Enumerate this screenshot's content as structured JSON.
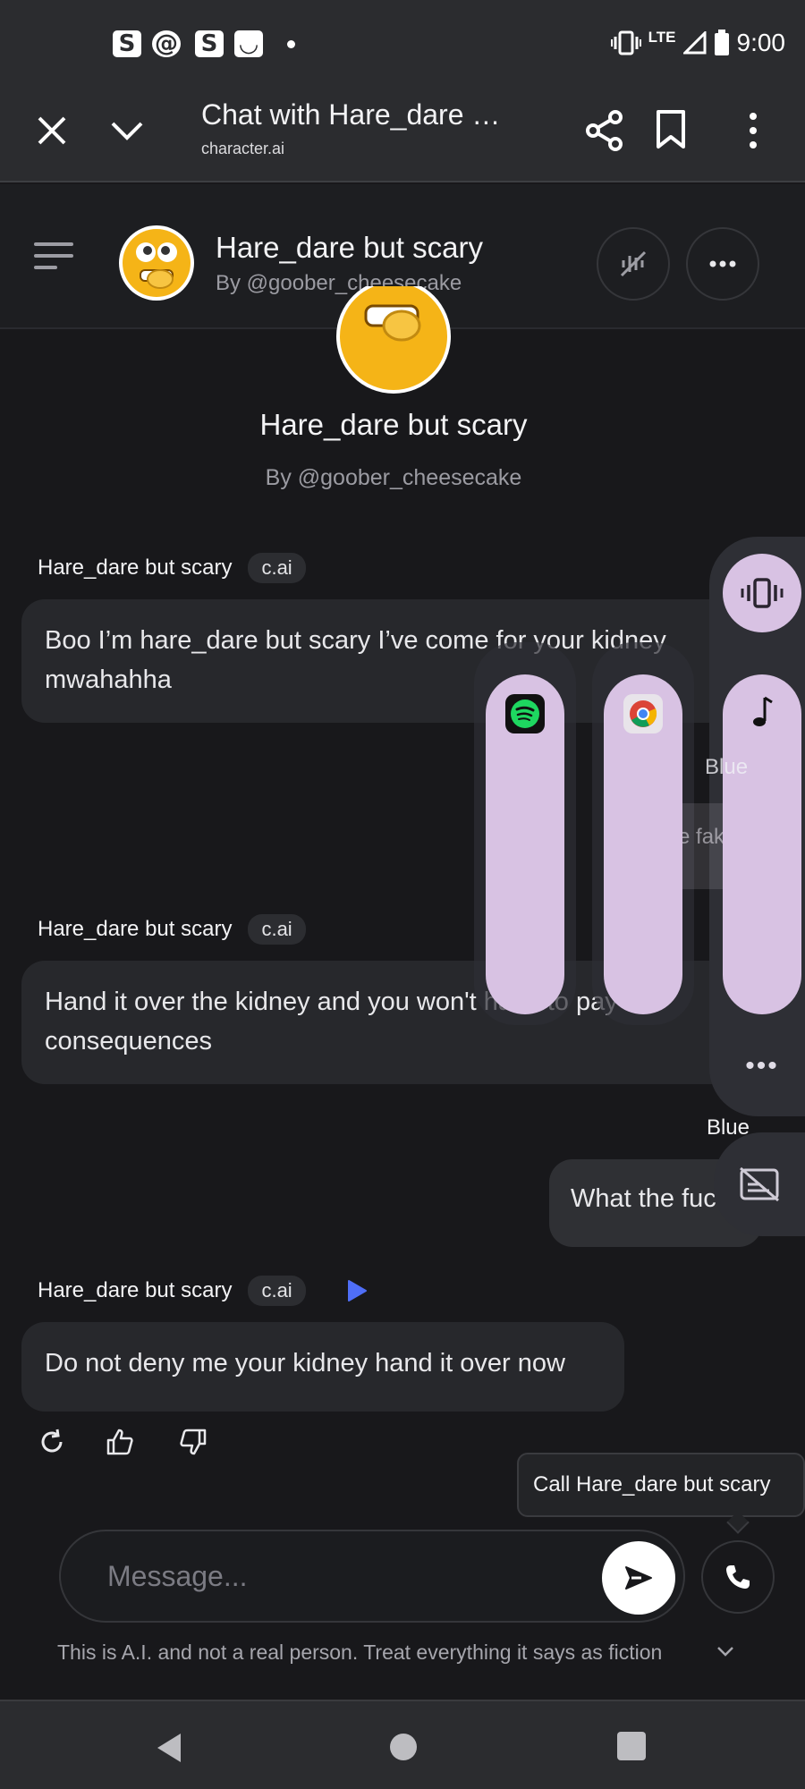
{
  "status_bar": {
    "left_icons": [
      "S",
      "@",
      "S",
      "◡"
    ],
    "network": "LTE",
    "time": "9:00"
  },
  "browser": {
    "title": "Chat with Hare_dare …",
    "url": "character.ai"
  },
  "chat_header": {
    "name": "Hare_dare but scary",
    "by": "By @goober_cheesecake"
  },
  "intro": {
    "name": "Hare_dare but scary",
    "by": "By @goober_cheesecake"
  },
  "messages": [
    {
      "sender": "Hare_dare but scary",
      "badge": "c.ai",
      "text": "Boo I’m hare_dare but scary I’ve come for your kidney mwahahha"
    },
    {
      "sender": "Hare_dare but scary",
      "badge": "c.ai",
      "text": "Hand it over the kidney and you won't have to pay the consequences"
    },
    {
      "sender": "Blue",
      "text": "What the fuck"
    },
    {
      "sender": "Hare_dare but scary",
      "badge": "c.ai",
      "text": "Do not deny me your kidney hand it over now"
    }
  ],
  "overlay_ghost": {
    "blue_label": "Blue",
    "bubble_text": "The fak"
  },
  "tooltip": "Call Hare_dare but scary",
  "input": {
    "placeholder": "Message..."
  },
  "disclaimer": "This is A.I. and not a real person. Treat everything it says as fiction",
  "colors": {
    "background": "#18181b",
    "bubble": "#27282c",
    "volume_slider": "#d8c2e3",
    "play_accent": "#4f6ef7"
  }
}
